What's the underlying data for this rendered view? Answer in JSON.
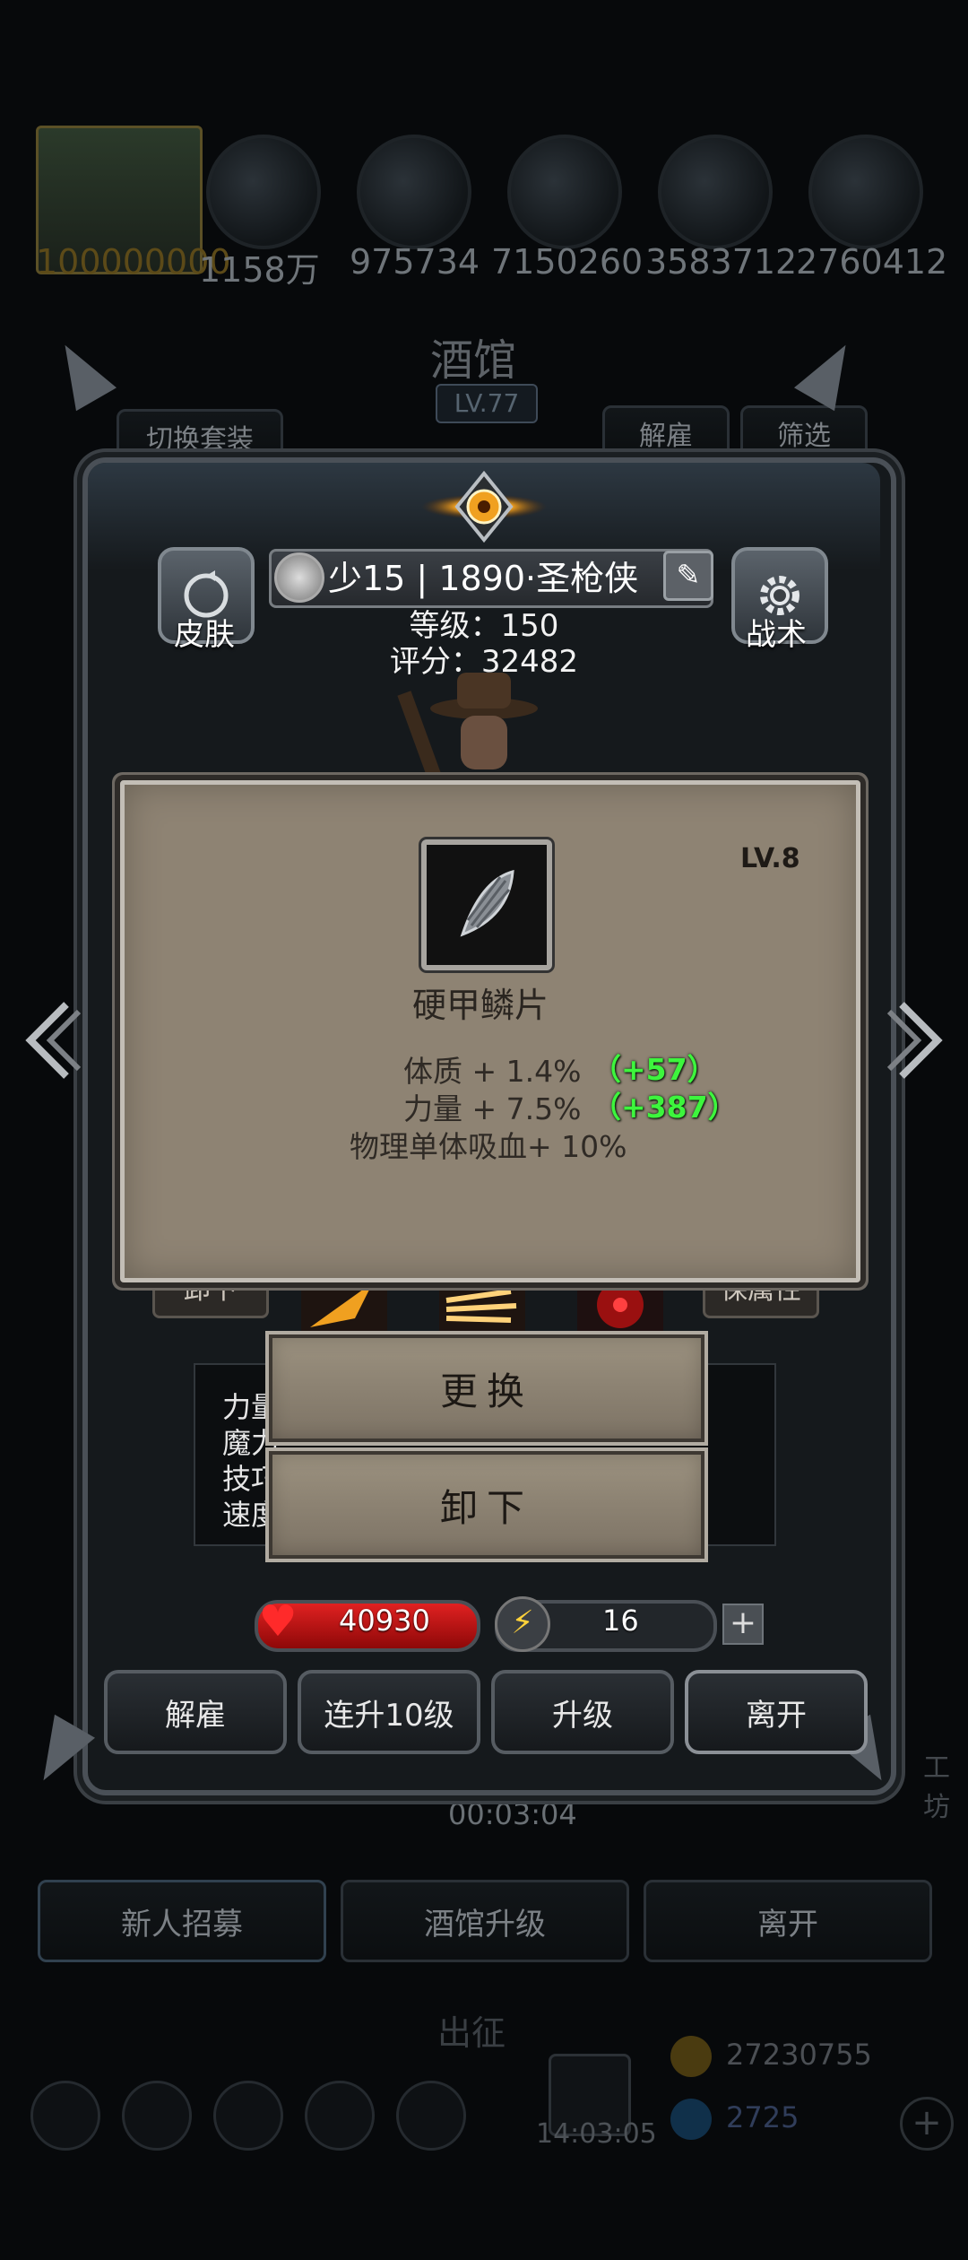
{
  "background": {
    "resources": [
      "100000000",
      "1158万",
      "975734",
      "7150260",
      "3583712",
      "2760412"
    ],
    "tavern_title": "酒馆",
    "tavern_level": "LV.77",
    "switch_outfit": "切换套装",
    "dismiss_top": "解雇",
    "filter": "筛选",
    "timer": "00:03:04",
    "recruit": "新人招募",
    "tavern_upgrade": "酒馆升级",
    "leave_bg": "离开",
    "expedition": "出征",
    "gold": "27230755",
    "gems": "2725",
    "clock": "14:03:05",
    "side_label": "工坊",
    "stat_labels": [
      "力量",
      "魔力",
      "技巧",
      "速度"
    ]
  },
  "hero": {
    "skin_label": "皮肤",
    "tactics_label": "战术",
    "name": "少15 | 1890·圣枪侠",
    "level_line": "等级：150",
    "score_line": "评分：32482",
    "unequip_side": "卸下",
    "attr_side": "保属性"
  },
  "item": {
    "level": "LV.8",
    "name": "硬甲鳞片",
    "attrs": [
      {
        "text": "体质 + 1.4%",
        "bonus": "（+57）"
      },
      {
        "text": "力量 + 7.5%",
        "bonus": "（+387）"
      },
      {
        "text": "物理单体吸血+ 10%",
        "bonus": ""
      }
    ],
    "icon": "armor-scale-icon"
  },
  "actions": {
    "replace": "更换",
    "unequip": "卸下"
  },
  "bars": {
    "hp": "40930",
    "energy": "16",
    "energy_fill": 0.12
  },
  "buttons": {
    "dismiss": "解雇",
    "upgrade10": "连升10级",
    "upgrade": "升级",
    "leave": "离开"
  },
  "colors": {
    "bonus": "#3df53d",
    "hp": "#e02121",
    "energy": "#e9c33b"
  }
}
